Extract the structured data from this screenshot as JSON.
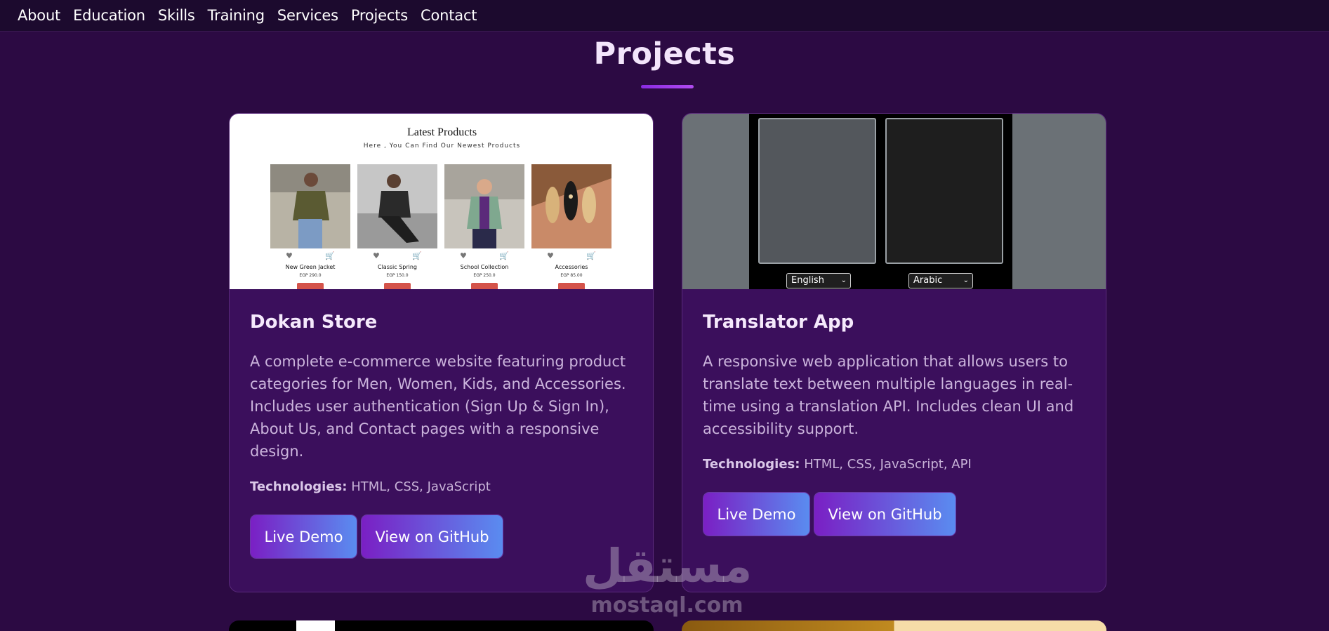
{
  "nav": {
    "items": [
      "About",
      "Education",
      "Skills",
      "Training",
      "Services",
      "Projects",
      "Contact"
    ]
  },
  "section": {
    "title": "Projects"
  },
  "projects": [
    {
      "title": "Dokan Store",
      "description": "A complete e-commerce website featuring product categories for Men, Women, Kids, and Accessories. Includes user authentication (Sign Up & Sign In), About Us, and Contact pages with a responsive design.",
      "tech_label": "Technologies:",
      "tech_list": "HTML, CSS, JavaScript",
      "demo_label": "Live Demo",
      "github_label": "View on GitHub",
      "preview": {
        "heading": "Latest Products",
        "subheading": "Here , You Can Find Our Newest Products",
        "products": [
          {
            "name": "New Green Jacket",
            "price": "EGP 290.0"
          },
          {
            "name": "Classic Spring",
            "price": "EGP 150.0"
          },
          {
            "name": "School Collection",
            "price": "EGP 250.0"
          },
          {
            "name": "Accessories",
            "price": "EGP 85.00"
          }
        ]
      }
    },
    {
      "title": "Translator App",
      "description": "A responsive web application that allows users to translate text between multiple languages in real-time using a translation API. Includes clean UI and accessibility support.",
      "tech_label": "Technologies:",
      "tech_list": "HTML, CSS, JavaScript, API",
      "demo_label": "Live Demo",
      "github_label": "View on GitHub",
      "preview": {
        "from_language": "English",
        "to_language": "Arabic"
      }
    }
  ],
  "watermark": {
    "arabic": "مستقل",
    "latin": "mostaql.com"
  },
  "colors": {
    "page_bg": "#2c0a43",
    "card_bg": "#3b0f5c",
    "button_start": "#7a1fc4",
    "button_end": "#5a8cf0",
    "accent": "#8a2be2"
  }
}
